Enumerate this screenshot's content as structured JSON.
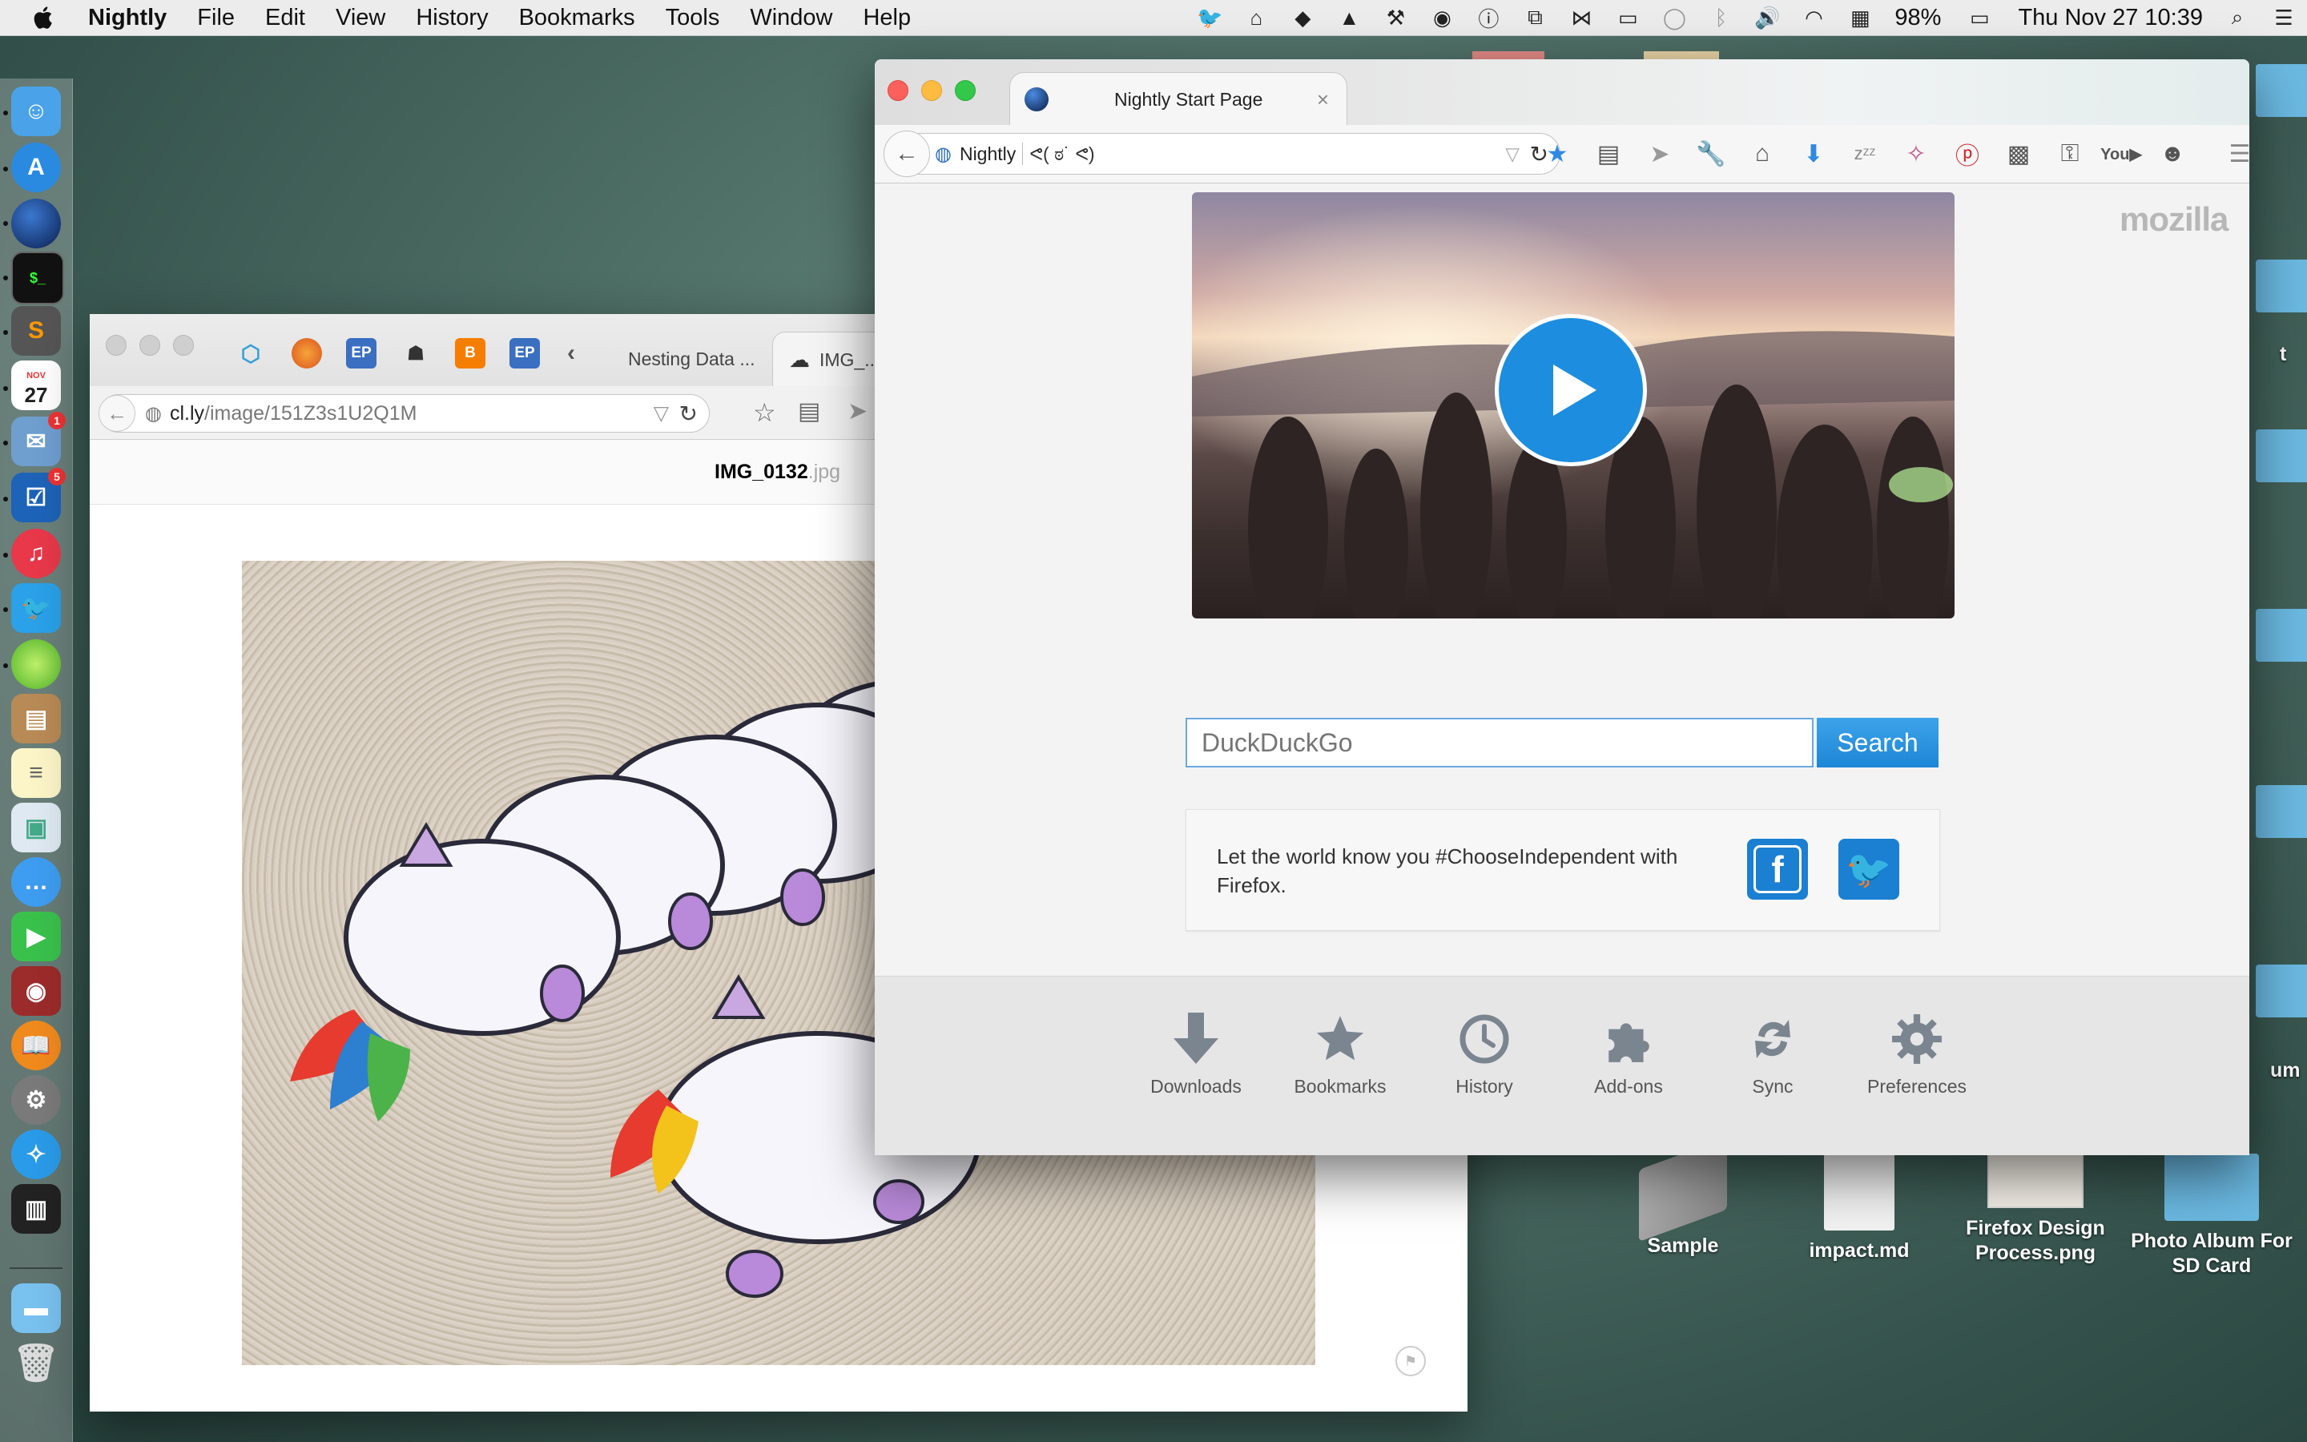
{
  "menubar": {
    "app_name": "Nightly",
    "menus": [
      "File",
      "Edit",
      "View",
      "History",
      "Bookmarks",
      "Tools",
      "Window",
      "Help"
    ],
    "battery": "98%",
    "clock": "Thu Nov 27  10:39"
  },
  "dock": {
    "calendar_month": "NOV",
    "calendar_day": "27",
    "badge_mail": "1",
    "badge_tasks": "5"
  },
  "desktop": {
    "icons": [
      {
        "label": "Sample"
      },
      {
        "label": "impact.md"
      },
      {
        "label": "Firefox Design Process.png"
      },
      {
        "label": "Photo Album For SD Card"
      }
    ],
    "edge_text_1": "t",
    "edge_text_2": "um"
  },
  "back_window": {
    "tabs": [
      {
        "label": "Nesting Data ..."
      },
      {
        "label": "IMG_..."
      }
    ],
    "url_domain": "cl.ly",
    "url_path": "/image/151Z3s1U2Q1M",
    "file_name": "IMG_0132",
    "file_ext": ".jpg"
  },
  "front_window": {
    "tab_title": "Nightly Start Page",
    "url_label": "Nightly",
    "url_text": "ᕙ( ಠ˙ ᕙ)",
    "brand": "mozilla",
    "search_placeholder": "DuckDuckGo",
    "search_button": "Search",
    "snippet_text": "Let the world know you #ChooseIndependent with Firefox.",
    "launcher": [
      {
        "label": "Downloads",
        "icon": "download-icon"
      },
      {
        "label": "Bookmarks",
        "icon": "star-icon"
      },
      {
        "label": "History",
        "icon": "clock-icon"
      },
      {
        "label": "Add-ons",
        "icon": "puzzle-icon"
      },
      {
        "label": "Sync",
        "icon": "sync-icon"
      },
      {
        "label": "Preferences",
        "icon": "gear-icon"
      }
    ]
  },
  "colors": {
    "accent_blue": "#1d86d6",
    "close_red": "#fc605c",
    "min_yellow": "#fdbc40",
    "max_green": "#34c84a"
  }
}
